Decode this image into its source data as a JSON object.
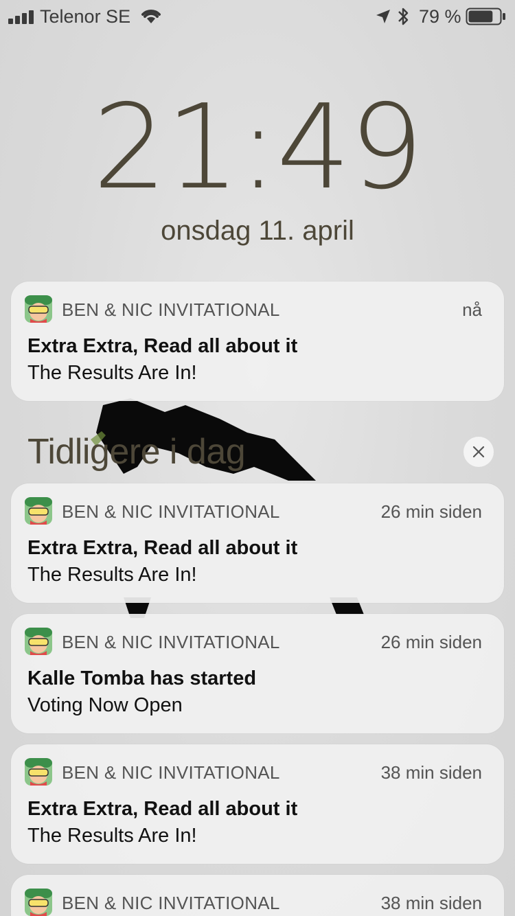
{
  "status_bar": {
    "carrier": "Telenor SE",
    "battery_percent": "79 %",
    "battery_level": 0.79,
    "signal_icon": "cellular-signal-icon",
    "wifi_icon": "wifi-icon",
    "location_icon": "location-arrow-icon",
    "bluetooth_icon": "bluetooth-icon",
    "battery_icon": "battery-icon"
  },
  "lock_screen": {
    "time": "21:49",
    "date": "onsdag 11. april"
  },
  "notifications": [
    {
      "app": "BEN & NIC INVITATIONAL",
      "time": "nå",
      "title": "Extra Extra, Read all about it",
      "body": "The Results Are In!"
    }
  ],
  "earlier_section": {
    "header": "Tidligere i dag",
    "clear_icon": "close-icon",
    "items": [
      {
        "app": "BEN & NIC INVITATIONAL",
        "time": "26 min siden",
        "title": "Extra Extra, Read all about it",
        "body": "The Results Are In!"
      },
      {
        "app": "BEN & NIC INVITATIONAL",
        "time": "26 min siden",
        "title": "Kalle Tomba has started",
        "body": "Voting Now Open"
      },
      {
        "app": "BEN & NIC INVITATIONAL",
        "time": "38 min siden",
        "title": "Extra Extra, Read all about it",
        "body": "The Results Are In!"
      },
      {
        "app": "BEN & NIC INVITATIONAL",
        "time": "38 min siden"
      }
    ]
  },
  "colors": {
    "clock": "#4d4738",
    "card_background": "#f0f0f0",
    "secondary_text": "#545454"
  }
}
